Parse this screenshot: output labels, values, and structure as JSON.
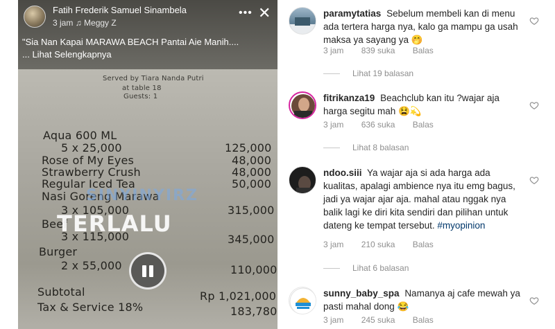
{
  "post": {
    "author": "Fatih Frederik Samuel Sinambela",
    "time": "3 jam",
    "audio_icon": "music-note-icon",
    "audio": "Meggy Z",
    "more_icon": "more-horizontal-icon",
    "close_icon": "close-icon",
    "caption": "\"Sia Nan Kapai MARAWA BEACH Pantai Aie Manih....",
    "see_more": "... Lihat Selengkapnya"
  },
  "video": {
    "receipt_header": [
      "Served by Tiara Nanda Putri",
      "at table 18",
      "Guests: 1"
    ],
    "receipt_items": [
      {
        "name": "Aqua 600 ML",
        "amount": ""
      },
      {
        "name": "5 x 25,000",
        "amount": "125,000"
      },
      {
        "name": "Rose of My Eyes",
        "amount": "48,000"
      },
      {
        "name": "Strawberry Crush",
        "amount": "48,000"
      },
      {
        "name": "Regular Iced Tea",
        "amount": "50,000"
      },
      {
        "name": "Nasi Goreng Marawa",
        "amount": ""
      },
      {
        "name": "3 x 105,000",
        "amount": "315,000"
      },
      {
        "name": "Beef",
        "amount": ""
      },
      {
        "name": "3 x 115,000",
        "amount": "345,000"
      },
      {
        "name": "Burger",
        "amount": ""
      },
      {
        "name": "2 x 55,000",
        "amount": "110,000"
      },
      {
        "name": "Subtotal",
        "amount": "Rp 1,021,000"
      },
      {
        "name": "Tax & Service 18%",
        "amount": "183,780"
      }
    ],
    "watermark_small": "SINYINYIRZ",
    "watermark_big": "TERLALU",
    "pause_icon": "pause-icon"
  },
  "comments": [
    {
      "username": "paramytatias",
      "text": "Sebelum membeli kan di menu ada tertera harga nya, kalo ga mampu ga usah maksa ya sayang ya 🤭",
      "time": "3 jam",
      "likes": "839 suka",
      "reply": "Balas",
      "view_replies": "Lihat 19 balasan"
    },
    {
      "username": "fitrikanza19",
      "text": "Beachclub kan itu ?wajar aja harga segitu mah 😫💫",
      "time": "3 jam",
      "likes": "636 suka",
      "reply": "Balas",
      "view_replies": "Lihat 8 balasan"
    },
    {
      "username": "ndoo.siii",
      "text": "Ya wajar aja si ada harga ada kualitas, apalagi ambience nya itu emg bagus, jadi ya wajar ajar aja. mahal atau nggak nya balik lagi ke diri kita sendiri dan pilihan untuk dateng ke tempat tersebut.",
      "hashtag": "#myopinion",
      "time": "3 jam",
      "likes": "210 suka",
      "reply": "Balas",
      "view_replies": "Lihat 6 balasan"
    },
    {
      "username": "sunny_baby_spa",
      "text": "Namanya aj cafe mewah ya pasti mahal dong 😂",
      "time": "3 jam",
      "likes": "245 suka",
      "reply": "Balas"
    }
  ],
  "colors": {
    "text": "#262626",
    "meta": "#8e8e8e",
    "hashtag": "#00376b",
    "story_ring": "#d6249f"
  }
}
